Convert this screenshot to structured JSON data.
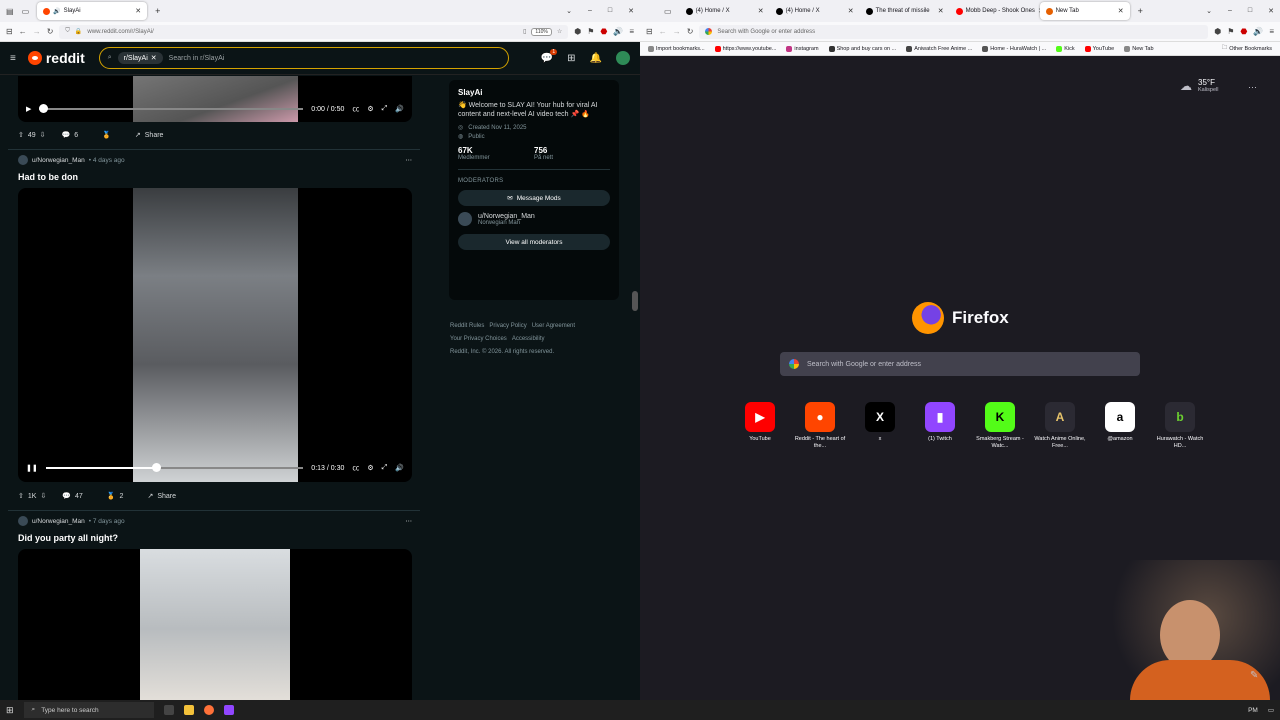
{
  "left_browser": {
    "tab_title": "SlayAi",
    "new_tab_symbol": "+",
    "url": "www.reddit.com/r/SlayAi/",
    "zoom": "110%",
    "window_controls": [
      "–",
      "□",
      "✕"
    ]
  },
  "reddit": {
    "logo_text": "reddit",
    "search_chip": "r/SlayAi",
    "search_placeholder": "Search in r/SlayAi",
    "notification_badge": "1",
    "post1": {
      "time": "0:00 / 0:50",
      "votes": "49",
      "comments": "6",
      "share": "Share"
    },
    "post2": {
      "author": "u/Norwegian_Man",
      "age": "• 4 days ago",
      "title": "Had to be don",
      "time": "0:13 / 0:30",
      "progress": 0.43,
      "votes": "1K",
      "comments": "47",
      "awards": "2",
      "share": "Share"
    },
    "post3": {
      "author": "u/Norwegian_Man",
      "age": "• 7 days ago",
      "title": "Did you party all night?"
    }
  },
  "sidebar": {
    "name": "SlayAi",
    "description": "👋 Welcome to SLAY AI! Your hub for viral AI content and next-level AI video tech 📌 🔥",
    "created": "Created Nov 11, 2025",
    "visibility": "Public",
    "members_count": "67K",
    "members_label": "Medlemmer",
    "online_count": "756",
    "online_label": "På nett",
    "moderators_heading": "MODERATORS",
    "message_mods": "Message Mods",
    "mod_name": "u/Norwegian_Man",
    "mod_sub": "Norwegian Man",
    "view_all": "View all moderators"
  },
  "footer": {
    "links": [
      "Reddit Rules",
      "Privacy Policy",
      "User Agreement",
      "Your Privacy Choices",
      "Accessibility"
    ],
    "copyright": "Reddit, Inc. © 2026. All rights reserved."
  },
  "right_browser": {
    "tabs": [
      {
        "title": "(4) Home / X",
        "color": "#000000"
      },
      {
        "title": "(4) Home / X",
        "color": "#000000"
      },
      {
        "title": "The threat of missile",
        "color": "#000000"
      },
      {
        "title": "Mobb Deep - Shook Ones",
        "color": "#ff0000"
      },
      {
        "title": "New Tab",
        "color": "#e66000"
      }
    ],
    "address_placeholder": "Search with Google or enter address",
    "bookmarks": [
      {
        "label": "Import bookmarks...",
        "color": "#888888"
      },
      {
        "label": "https://www.youtube...",
        "color": "#ff0000"
      },
      {
        "label": "instagram",
        "color": "#c13584"
      },
      {
        "label": "Shop and buy cars on ...",
        "color": "#333333"
      },
      {
        "label": "Aniwatch Free Anime ...",
        "color": "#444444"
      },
      {
        "label": "Home - HuraWatch | ...",
        "color": "#555555"
      },
      {
        "label": "Kick",
        "color": "#53fc18"
      },
      {
        "label": "YouTube",
        "color": "#ff0000"
      },
      {
        "label": "New Tab",
        "color": "#888888"
      }
    ],
    "other_bookmarks": "Other Bookmarks",
    "weather_temp": "35°F",
    "weather_city": "Kalispell",
    "brand": "Firefox",
    "search_placeholder": "Search with Google or enter address",
    "shortcuts": [
      {
        "label": "YouTube",
        "glyph": "▶",
        "bg": "#ff0000",
        "fg": "#ffffff"
      },
      {
        "label": "Reddit - The heart of the...",
        "glyph": "●",
        "bg": "#ff4500",
        "fg": "#ffffff"
      },
      {
        "label": "x",
        "glyph": "X",
        "bg": "#000000",
        "fg": "#ffffff"
      },
      {
        "label": "(1) Twitch",
        "glyph": "▮",
        "bg": "#9146ff",
        "fg": "#ffffff"
      },
      {
        "label": "Smakberg Stream - Watc...",
        "glyph": "K",
        "bg": "#53fc18",
        "fg": "#000000"
      },
      {
        "label": "Watch Anime Online, Free...",
        "glyph": "A",
        "bg": "#2b2a33",
        "fg": "#e6c36a"
      },
      {
        "label": "@amazon",
        "glyph": "a",
        "bg": "#ffffff",
        "fg": "#000000"
      },
      {
        "label": "Hurawatch - Watch HD...",
        "glyph": "b",
        "bg": "#2b2a33",
        "fg": "#6cd030"
      }
    ]
  },
  "taskbar": {
    "search_placeholder": "Type here to search",
    "time": "PM"
  }
}
